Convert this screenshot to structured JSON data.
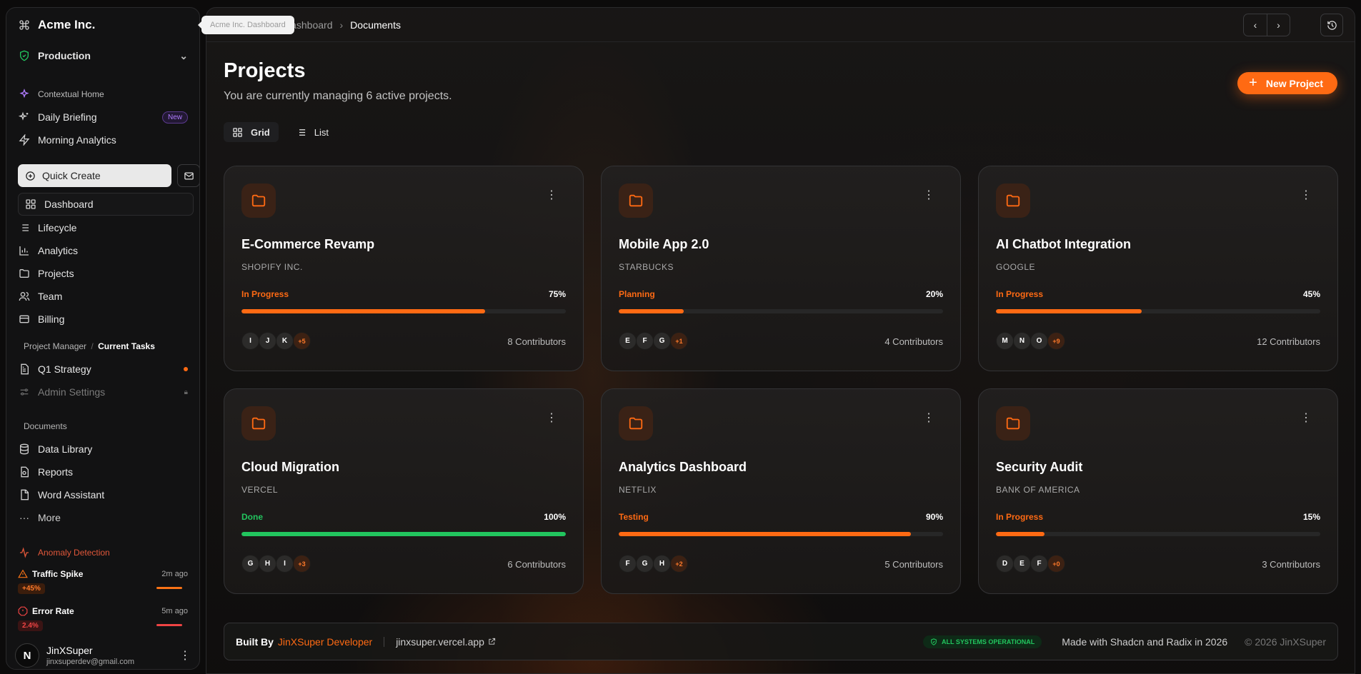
{
  "colors": {
    "accent": "#ff6a13",
    "success": "#22c55e",
    "danger": "#ef4444"
  },
  "sidebar": {
    "brand": "Acme Inc.",
    "tooltip": "Acme Inc. Dashboard",
    "environment": "Production",
    "contextual_home_label": "Contextual Home",
    "daily_briefing": "Daily Briefing",
    "new_badge": "New",
    "morning_analytics": "Morning Analytics",
    "quick_create": "Quick Create",
    "nav": [
      {
        "label": "Dashboard",
        "icon": "dashboard-icon"
      },
      {
        "label": "Lifecycle",
        "icon": "list-icon"
      },
      {
        "label": "Analytics",
        "icon": "chart-icon"
      },
      {
        "label": "Projects",
        "icon": "folder-icon"
      },
      {
        "label": "Team",
        "icon": "users-icon"
      },
      {
        "label": "Billing",
        "icon": "card-icon"
      }
    ],
    "pm_label": "Project Manager",
    "pm_current": "Current Tasks",
    "q1_strategy": "Q1 Strategy",
    "admin_settings": "Admin Settings",
    "documents_label": "Documents",
    "documents": [
      {
        "label": "Data Library",
        "icon": "database-icon"
      },
      {
        "label": "Reports",
        "icon": "report-icon"
      },
      {
        "label": "Word Assistant",
        "icon": "file-icon"
      },
      {
        "label": "More",
        "icon": "more-icon"
      }
    ],
    "anomaly_label": "Anomaly Detection",
    "alerts": [
      {
        "title": "Traffic Spike",
        "time": "2m ago",
        "value": "+45%"
      },
      {
        "title": "Error Rate",
        "time": "5m ago",
        "value": "2.4%"
      }
    ],
    "user": {
      "initial": "N",
      "name": "JinXSuper",
      "email": "jinxsuperdev@gmail.com"
    }
  },
  "header": {
    "breadcrumb_parent": "Dashboard",
    "breadcrumb_current": "Documents"
  },
  "main": {
    "title": "Projects",
    "subtitle": "You are currently managing 6 active projects.",
    "new_project": "New Project",
    "view_grid": "Grid",
    "view_list": "List",
    "projects": [
      {
        "title": "E-Commerce Revamp",
        "client": "SHOPIFY INC.",
        "status": "In Progress",
        "status_color": "#ff6a13",
        "progress_label": "75%",
        "progress": 75,
        "avatars": [
          "I",
          "J",
          "K"
        ],
        "more": "+5",
        "contributors": "8 Contributors"
      },
      {
        "title": "Mobile App 2.0",
        "client": "STARBUCKS",
        "status": "Planning",
        "status_color": "#ff6a13",
        "progress_label": "20%",
        "progress": 20,
        "avatars": [
          "E",
          "F",
          "G"
        ],
        "more": "+1",
        "contributors": "4 Contributors"
      },
      {
        "title": "AI Chatbot Integration",
        "client": "GOOGLE",
        "status": "In Progress",
        "status_color": "#ff6a13",
        "progress_label": "45%",
        "progress": 45,
        "avatars": [
          "M",
          "N",
          "O"
        ],
        "more": "+9",
        "contributors": "12 Contributors"
      },
      {
        "title": "Cloud Migration",
        "client": "VERCEL",
        "status": "Done",
        "status_color": "#22c55e",
        "progress_label": "100%",
        "progress": 100,
        "avatars": [
          "G",
          "H",
          "I"
        ],
        "more": "+3",
        "contributors": "6 Contributors"
      },
      {
        "title": "Analytics Dashboard",
        "client": "NETFLIX",
        "status": "Testing",
        "status_color": "#ff6a13",
        "progress_label": "90%",
        "progress": 90,
        "avatars": [
          "F",
          "G",
          "H"
        ],
        "more": "+2",
        "contributors": "5 Contributors"
      },
      {
        "title": "Security Audit",
        "client": "BANK OF AMERICA",
        "status": "In Progress",
        "status_color": "#ff6a13",
        "progress_label": "15%",
        "progress": 15,
        "avatars": [
          "D",
          "E",
          "F"
        ],
        "more": "+0",
        "contributors": "3 Contributors"
      }
    ]
  },
  "footer": {
    "built_by_label": "Built By",
    "built_by_name": "JinXSuper Developer",
    "link": "jinxsuper.vercel.app",
    "status": "ALL SYSTEMS OPERATIONAL",
    "made_with": "Made with Shadcn and Radix in 2026",
    "copyright": "© 2026 JinXSuper"
  }
}
